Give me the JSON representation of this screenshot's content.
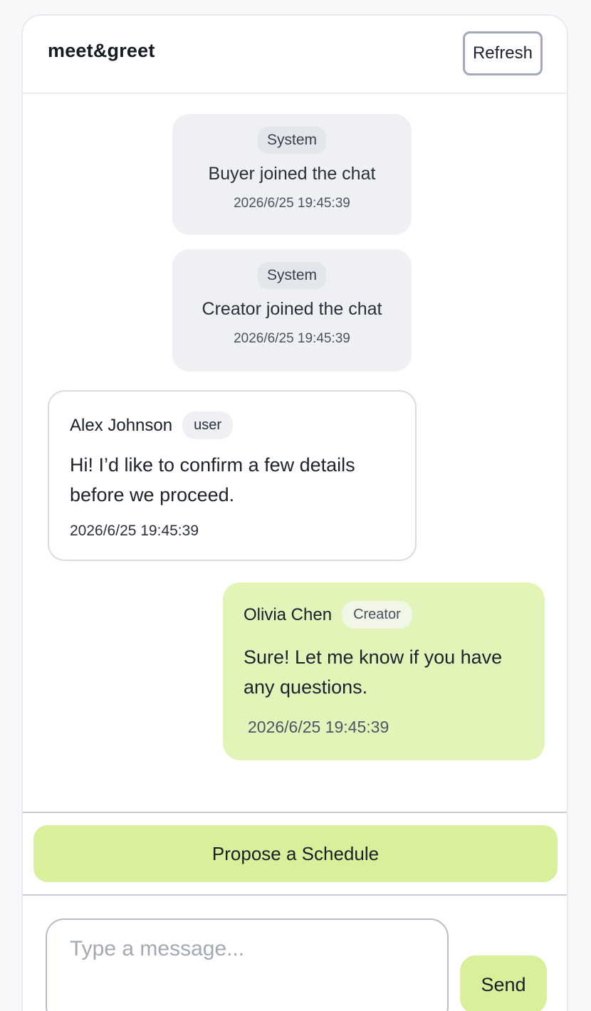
{
  "header": {
    "title": "meet&greet",
    "refresh_label": "Refresh"
  },
  "messages": [
    {
      "type": "system",
      "tag": "System",
      "text": "Buyer joined the chat",
      "time": "2026/6/25 19:45:39"
    },
    {
      "type": "system",
      "tag": "System",
      "text": "Creator joined the chat",
      "time": "2026/6/25 19:45:39"
    },
    {
      "type": "user",
      "sender": "Alex Johnson",
      "role": "user",
      "text": "Hi! I’d like to confirm a few details before we proceed.",
      "time": "2026/6/25 19:45:39"
    },
    {
      "type": "creator",
      "sender": "Olivia Chen",
      "role": "Creator",
      "text": "Sure! Let me know if you have any questions.",
      "time": "2026/6/25 19:45:39"
    }
  ],
  "actions": {
    "propose_schedule_label": "Propose a Schedule"
  },
  "composer": {
    "placeholder": "Type a message...",
    "value": "",
    "send_label": "Send"
  },
  "colors": {
    "accent": "#d8f09a",
    "creator_bubble": "#e3f4b8",
    "system_bubble": "#eef0f3"
  }
}
